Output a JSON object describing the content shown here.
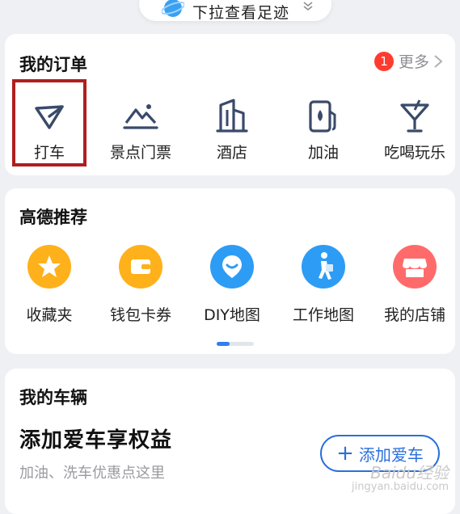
{
  "top_pill": {
    "label": "下拉查看足迹"
  },
  "orders": {
    "title": "我的订单",
    "badge_count": "1",
    "more_label": "更多",
    "items": [
      {
        "label": "打车",
        "icon": "taxi-icon"
      },
      {
        "label": "景点门票",
        "icon": "scenic-ticket-icon"
      },
      {
        "label": "酒店",
        "icon": "hotel-icon"
      },
      {
        "label": "加油",
        "icon": "gas-station-icon"
      },
      {
        "label": "吃喝玩乐",
        "icon": "cocktail-icon"
      }
    ]
  },
  "recommend": {
    "title": "高德推荐",
    "items": [
      {
        "label": "收藏夹",
        "icon": "star-icon",
        "color": "#ffb11b"
      },
      {
        "label": "钱包卡券",
        "icon": "wallet-icon",
        "color": "#ffb11b"
      },
      {
        "label": "DIY地图",
        "icon": "diy-map-icon",
        "color": "#2d9cf5"
      },
      {
        "label": "工作地图",
        "icon": "walking-person-icon",
        "color": "#2d9cf5"
      },
      {
        "label": "我的店铺",
        "icon": "shop-icon",
        "color": "#ff6b6b"
      }
    ]
  },
  "vehicle": {
    "title": "我的车辆",
    "headline": "添加爱车享权益",
    "subtitle": "加油、洗车优惠点这里",
    "add_button": "添加爱车"
  },
  "watermark": {
    "line1": "Baidu经验",
    "line2": "jingyan.baidu.com"
  },
  "colors": {
    "accent": "#2a6fdb",
    "badge": "#ff3b30",
    "highlight_box": "#b01e1e",
    "icon_line": "#3a4a6b"
  }
}
